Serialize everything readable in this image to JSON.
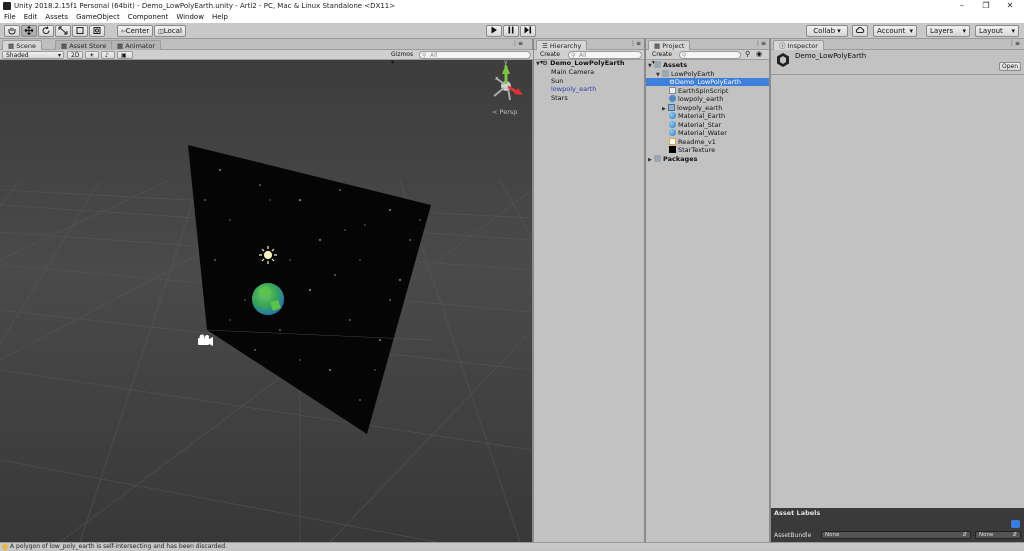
{
  "window": {
    "title": "Unity 2018.2.15f1 Personal (64bit) - Demo_LowPolyEarth.unity - Arti2 - PC, Mac & Linux Standalone <DX11>",
    "controls": [
      "–",
      "❐",
      "✕"
    ]
  },
  "menu": [
    "File",
    "Edit",
    "Assets",
    "GameObject",
    "Component",
    "Window",
    "Help"
  ],
  "toolbar": {
    "pivot_label": "Center",
    "space_label": "Local",
    "collab_label": "Collab ▾",
    "account_label": "Account",
    "layers_label": "Layers",
    "layout_label": "Layout"
  },
  "scene_panel": {
    "tabs": [
      "Scene",
      "Asset Store",
      "Animator"
    ],
    "shading": "Shaded",
    "mode_2d": "2D",
    "gizmos": "Gizmos",
    "search_placeholder": "All",
    "persp_label": "< Persp"
  },
  "hierarchy": {
    "tab": "Hierarchy",
    "create": "Create",
    "search_placeholder": "All",
    "scene_name": "Demo_LowPolyEarth",
    "items": [
      "Main Camera",
      "Sun",
      "lowpoly_earth",
      "Stars"
    ]
  },
  "project": {
    "tab": "Project",
    "create": "Create",
    "assets_label": "Assets",
    "folder_label": "LowPolyEarth",
    "items": [
      {
        "label": "Demo_LowPolyEarth",
        "icon": "unity-scene-icon",
        "selected": true
      },
      {
        "label": "EarthSpinScript",
        "icon": "script-icon",
        "selected": false
      },
      {
        "label": "lowpoly_earth",
        "icon": "prefab-icon",
        "selected": false
      },
      {
        "label": "lowpoly_earth",
        "icon": "model-icon",
        "selected": false
      },
      {
        "label": "Material_Earth",
        "icon": "material-icon",
        "selected": false
      },
      {
        "label": "Material_Star",
        "icon": "material-icon",
        "selected": false
      },
      {
        "label": "Material_Water",
        "icon": "material-icon",
        "selected": false
      },
      {
        "label": "Readme_v1",
        "icon": "readme-icon",
        "selected": false
      },
      {
        "label": "StarTexture",
        "icon": "texture-icon",
        "selected": false
      }
    ],
    "packages_label": "Packages"
  },
  "inspector": {
    "tab": "Inspector",
    "asset_name": "Demo_LowPolyEarth",
    "open_button": "Open",
    "asset_labels": "Asset Labels",
    "assetbundle_label": "AssetBundle",
    "assetbundle_value": "None",
    "variant_value": "None"
  },
  "status": {
    "message": "A polygon of low_poly_earth is self-intersecting and has been discarded."
  },
  "colors": {
    "selection": "#3d7fd9",
    "scene_bg": "#3f3f3f",
    "earth_land": "#3fae3a",
    "earth_water": "#2a8fd8"
  }
}
